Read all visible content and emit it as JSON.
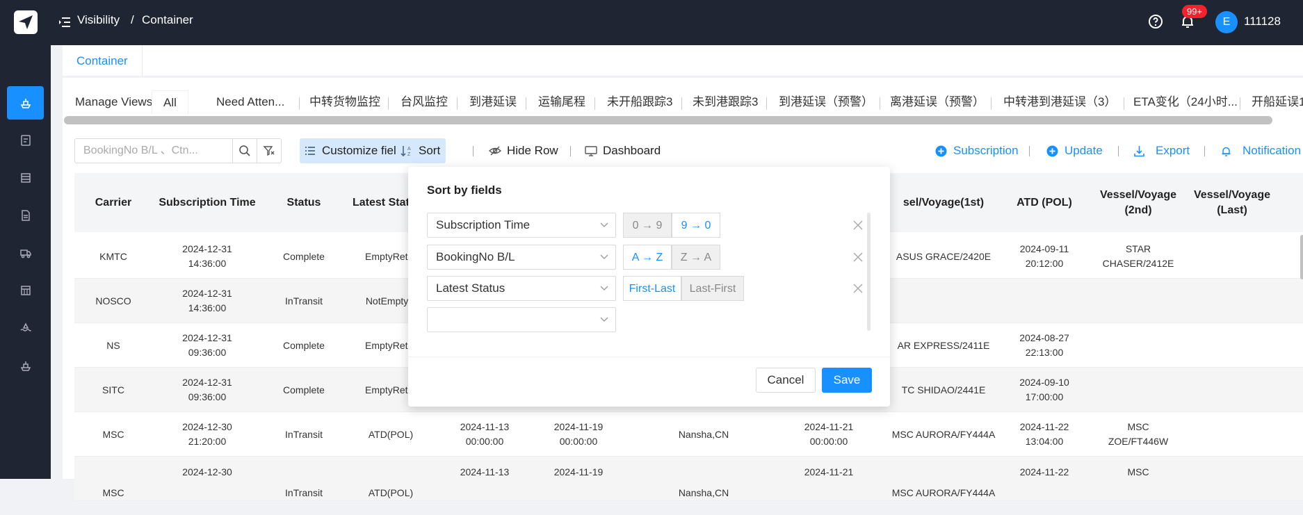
{
  "header": {
    "breadcrumb_1": "Visibility",
    "breadcrumb_sep": "/",
    "breadcrumb_2": "Container",
    "notification_count": "99+",
    "avatar_letter": "E",
    "username": "111128"
  },
  "page_tab": "Container",
  "view_tabs": {
    "manage": "Manage Views",
    "all": "All",
    "need_attention": "Need Atten...",
    "t1": "中转货物监控",
    "t2": "台风监控",
    "t3": "到港延误",
    "t4": "运输尾程",
    "t5": "未开船跟踪3",
    "t6": "未到港跟踪3",
    "t7": "到港延误（预警）",
    "t8": "离港延误（预警）",
    "t9": "中转港到港延误（3）",
    "t10": "ETA变化（24小时...",
    "t11": "开船延误1"
  },
  "toolbar": {
    "search_placeholder": "BookingNo B/L 、Ctn...",
    "customize": "Customize field",
    "sort": "Sort",
    "hide_row": "Hide Row",
    "dashboard": "Dashboard",
    "subscription": "Subscription",
    "update": "Update",
    "export": "Export",
    "notification": "Notification"
  },
  "table": {
    "headers": {
      "carrier": "Carrier",
      "sub_time": "Subscription Time",
      "status": "Status",
      "latest_status": "Latest Stat",
      "vessel_first": "sel/Voyage(1st)",
      "atd": "ATD  (POL)",
      "vessel_2nd": "Vessel/Voyage (2nd)",
      "vessel_last": "Vessel/Voyage (Last)"
    },
    "rows": [
      {
        "carrier": "KMTC",
        "sub_date": "2024-12-31",
        "sub_time": "14:36:00",
        "status": "Complete",
        "latest": "EmptyRetur",
        "vessel1": "ASUS GRACE/2420E",
        "atd_date": "2024-09-11",
        "atd_time": "20:12:00",
        "v2a": "STAR",
        "v2b": "CHASER/2412E"
      },
      {
        "carrier": "NOSCO",
        "sub_date": "2024-12-31",
        "sub_time": "14:36:00",
        "status": "InTransit",
        "latest": "NotEmptyO"
      },
      {
        "carrier": "NS",
        "sub_date": "2024-12-31",
        "sub_time": "09:36:00",
        "status": "Complete",
        "latest": "EmptyRetur",
        "vessel1": "AR EXPRESS/2411E",
        "atd_date": "2024-08-27",
        "atd_time": "22:13:00"
      },
      {
        "carrier": "SITC",
        "sub_date": "2024-12-31",
        "sub_time": "09:36:00",
        "status": "Complete",
        "latest": "EmptyRetur",
        "vessel1": "TC SHIDAO/2441E",
        "atd_date": "2024-09-10",
        "atd_time": "17:00:00"
      },
      {
        "carrier": "MSC",
        "sub_date": "2024-12-30",
        "sub_time": "21:20:00",
        "status": "InTransit",
        "latest": "ATD(POL)",
        "c5a": "2024-11-13",
        "c5b": "00:00:00",
        "c6a": "2024-11-19",
        "c6b": "00:00:00",
        "port": "Nansha,CN",
        "c8a": "2024-11-21",
        "c8b": "00:00:00",
        "vessel1": "MSC AURORA/FY444A",
        "atd_date": "2024-11-22",
        "atd_time": "13:04:00",
        "v2a": "MSC",
        "v2b": "ZOE/FT446W"
      },
      {
        "carrier": "MSC",
        "sub_date": "2024-12-30",
        "status": "InTransit",
        "latest": "ATD(POL)",
        "c5a": "2024-11-13",
        "c6a": "2024-11-19",
        "port": "Nansha,CN",
        "c8a": "2024-11-21",
        "vessel1": "MSC AURORA/FY444A",
        "atd_date": "2024-11-22",
        "v2a": "MSC"
      }
    ]
  },
  "sort_popup": {
    "title": "Sort by fields",
    "field1": "Subscription Time",
    "field1_asc": "0 → 9",
    "field1_desc": "9 → 0",
    "field2": "BookingNo B/L",
    "field2_asc": "A → Z",
    "field2_desc": "Z → A",
    "field3": "Latest Status",
    "field3_asc": "First-Last",
    "field3_desc": "Last-First",
    "field4": "",
    "cancel": "Cancel",
    "save": "Save"
  },
  "colors": {
    "primary": "#1890ff",
    "dark": "#1f2533"
  }
}
